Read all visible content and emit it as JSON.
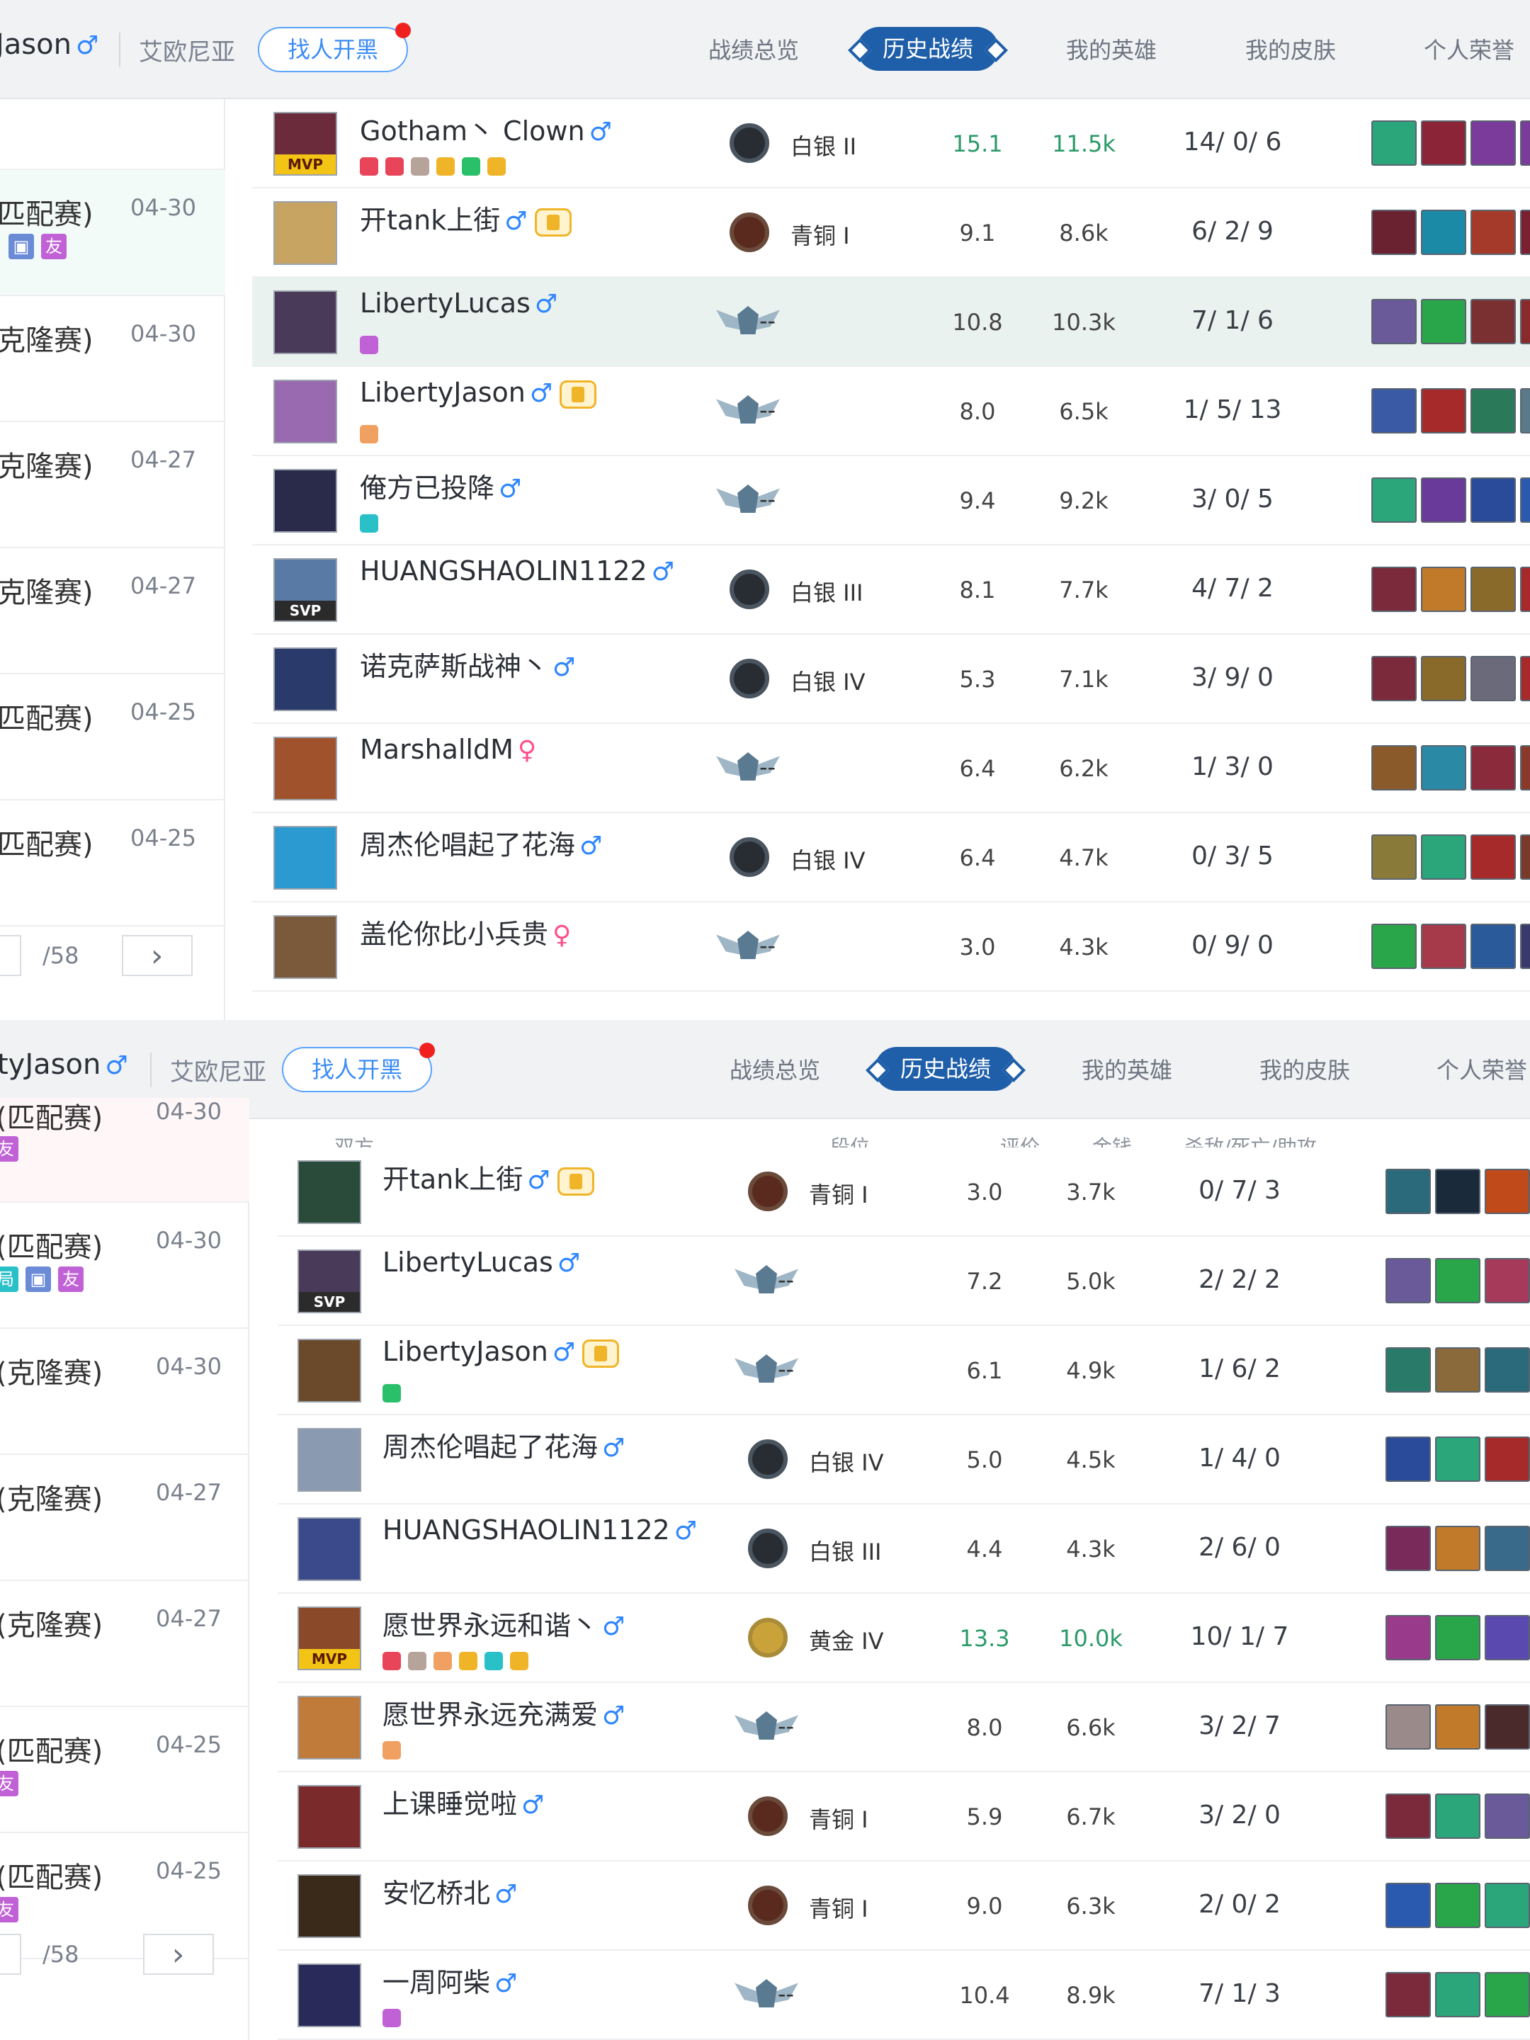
{
  "colors": {
    "accent": "#1f5fa9",
    "male": "#2f86ff",
    "female": "#ff4f8b",
    "green": "#2b9a69"
  },
  "panels": [
    {
      "header": {
        "username": "Jason",
        "server": "艾欧尼亚",
        "find_btn": "找人开黑",
        "tabs": [
          "战绩总览",
          "历史战绩",
          "我的英雄",
          "我的皮肤",
          "个人荣誉"
        ],
        "active_tab": 1
      },
      "matches": [
        {
          "mode": "",
          "date": "",
          "badges": []
        },
        {
          "mode": "匹配赛)",
          "date": "04-30",
          "badges": [
            "pic",
            "friend"
          ]
        },
        {
          "mode": "克隆赛)",
          "date": "04-30",
          "badges": []
        },
        {
          "mode": "克隆赛)",
          "date": "04-27",
          "badges": []
        },
        {
          "mode": "克隆赛)",
          "date": "04-27",
          "badges": []
        },
        {
          "mode": "匹配赛)",
          "date": "04-25",
          "badges": []
        },
        {
          "mode": "匹配赛)",
          "date": "04-25",
          "badges": []
        }
      ],
      "pager": {
        "total": "/58",
        "next": "›"
      },
      "columns": [],
      "players": [
        {
          "name": "Gotham丶 Clown",
          "gender": "male",
          "vip": false,
          "av": "#6b2b3b",
          "mark": "MVP",
          "tags": [
            "#e8455a",
            "#e8455a",
            "#b6a39a",
            "#f0b429",
            "#2ac06a",
            "#f0b429"
          ],
          "rank": "silver",
          "rank_text": "白银 II",
          "score": "15.1",
          "gold": "11.5k",
          "kda": "14/ 0/ 6",
          "green": true,
          "items": [
            "#2aa67a",
            "#8a2436",
            "#7a3b9a",
            "#7a3b9a",
            "#2a4a9a"
          ]
        },
        {
          "name": "开tank上街",
          "gender": "male",
          "vip": true,
          "av": "#c7a462",
          "mark": "",
          "tags": [],
          "rank": "bronze",
          "rank_text": "青铜 I",
          "score": "9.1",
          "gold": "8.6k",
          "kda": "6/ 2/ 9",
          "green": false,
          "items": [
            "#6a2230",
            "#1a8aa6",
            "#a63a2a",
            "#7a2030",
            "#8a6a3a"
          ]
        },
        {
          "name": "LibertyLucas",
          "gender": "male",
          "vip": false,
          "av": "#4a3a5a",
          "mark": "",
          "tags": [
            "#c062d6"
          ],
          "rank": "wing",
          "rank_text": "--",
          "score": "10.8",
          "gold": "10.3k",
          "kda": "7/ 1/ 6",
          "green": false,
          "items": [
            "#6a5a9a",
            "#2aa64a",
            "#7a3030",
            "#8a2a2a",
            "#6a2a2a"
          ],
          "hl": true
        },
        {
          "name": "LibertyJason",
          "gender": "male",
          "vip": true,
          "av": "#9a6ab0",
          "mark": "",
          "tags": [
            "#f0a060"
          ],
          "rank": "wing",
          "rank_text": "--",
          "score": "8.0",
          "gold": "6.5k",
          "kda": "1/ 5/ 13",
          "green": false,
          "items": [
            "#3a5aa6",
            "#a62a2a",
            "#2a7a5a",
            "#5a7a8a",
            "#a66a2a"
          ]
        },
        {
          "name": "俺方已投降",
          "gender": "male",
          "vip": false,
          "av": "#2a2a4a",
          "mark": "",
          "tags": [
            "#2ac0c8"
          ],
          "rank": "wing",
          "rank_text": "--",
          "score": "9.4",
          "gold": "9.2k",
          "kda": "3/ 0/ 5",
          "green": false,
          "items": [
            "#2aa67a",
            "#6a3a9a",
            "#2a4a9a",
            "#2a5ab0",
            "#3a4a8a"
          ]
        },
        {
          "name": "HUANGSHAOLIN1122",
          "gender": "male",
          "vip": false,
          "av": "#5a7aa6",
          "mark": "SVP",
          "tags": [],
          "rank": "silver",
          "rank_text": "白银 III",
          "score": "8.1",
          "gold": "7.7k",
          "kda": "4/ 7/ 2",
          "green": false,
          "items": [
            "#7a2a3a",
            "#c07a2a",
            "#8a6a2a",
            "#a62a2a",
            "#6a2a2a"
          ]
        },
        {
          "name": "诺克萨斯战神丶",
          "gender": "male",
          "vip": false,
          "av": "#2a3a6a",
          "mark": "",
          "tags": [],
          "rank": "silver",
          "rank_text": "白银 IV",
          "score": "5.3",
          "gold": "7.1k",
          "kda": "3/ 9/ 0",
          "green": false,
          "items": [
            "#7a2a3a",
            "#8a6a2a",
            "#6a6a7a",
            "#a62a2a",
            "#3a7a3a"
          ]
        },
        {
          "name": "MarshalldM",
          "gender": "female",
          "vip": false,
          "av": "#a0522d",
          "mark": "",
          "tags": [],
          "rank": "wing",
          "rank_text": "--",
          "score": "6.4",
          "gold": "6.2k",
          "kda": "1/ 3/ 0",
          "green": false,
          "items": [
            "#8a5a2a",
            "#2a8aa6",
            "#8a2a3a",
            "#8a3a2a",
            "#5a3a2a"
          ]
        },
        {
          "name": "周杰伦唱起了花海",
          "gender": "male",
          "vip": false,
          "av": "#2a9ad0",
          "mark": "",
          "tags": [],
          "rank": "silver",
          "rank_text": "白银 IV",
          "score": "6.4",
          "gold": "4.7k",
          "kda": "0/ 3/ 5",
          "green": false,
          "items": [
            "#8a7a3a",
            "#2aa67a",
            "#a62a2a",
            "#7a3a2a",
            "#5a5a3a"
          ]
        },
        {
          "name": "盖伦你比小兵贵",
          "gender": "female",
          "vip": false,
          "av": "#7a5a3a",
          "mark": "",
          "tags": [],
          "rank": "wing",
          "rank_text": "--",
          "score": "3.0",
          "gold": "4.3k",
          "kda": "0/ 9/ 0",
          "green": false,
          "items": [
            "#2aa64a",
            "#a63a4a",
            "#2a5a9a",
            "#3a3a6a",
            "#2a4a8a"
          ]
        }
      ]
    },
    {
      "header": {
        "username": "tyJason",
        "server": "艾欧尼亚",
        "find_btn": "找人开黑",
        "tabs": [
          "战绩总览",
          "历史战绩",
          "我的英雄",
          "我的皮肤",
          "个人荣誉"
        ],
        "active_tab": 1
      },
      "matches": [
        {
          "mode": "(匹配赛)",
          "date": "04-30",
          "badges": [
            "friend"
          ],
          "pink": true,
          "partial": true
        },
        {
          "mode": "(匹配赛)",
          "date": "04-30",
          "badges": [
            "ju",
            "pic",
            "friend"
          ]
        },
        {
          "mode": "(克隆赛)",
          "date": "04-30",
          "badges": []
        },
        {
          "mode": "(克隆赛)",
          "date": "04-27",
          "badges": []
        },
        {
          "mode": "(克隆赛)",
          "date": "04-27",
          "badges": []
        },
        {
          "mode": "(匹配赛)",
          "date": "04-25",
          "badges": [
            "friend"
          ]
        },
        {
          "mode": "(匹配赛)",
          "date": "04-25",
          "badges": [
            "friend"
          ]
        }
      ],
      "pager": {
        "total": "/58",
        "next": "›"
      },
      "columns": [
        "双方",
        "段位",
        "评价",
        "金钱",
        "杀敌/死亡/助攻"
      ],
      "players": [
        {
          "name": "开tank上街",
          "gender": "male",
          "vip": true,
          "av": "#2a4a3a",
          "mark": "",
          "tags": [],
          "rank": "bronze",
          "rank_text": "青铜 I",
          "score": "3.0",
          "gold": "3.7k",
          "kda": "0/ 7/ 3",
          "green": false,
          "items": [
            "#2a6a7a",
            "#1a2a3a",
            "#c04a1a",
            "#3a3a4a",
            "#4a4a5a"
          ]
        },
        {
          "name": "LibertyLucas",
          "gender": "male",
          "vip": false,
          "av": "#4a3a5a",
          "mark": "SVP",
          "tags": [],
          "rank": "wing",
          "rank_text": "--",
          "score": "7.2",
          "gold": "5.0k",
          "kda": "2/ 2/ 2",
          "green": false,
          "items": [
            "#6a5a9a",
            "#2aa64a",
            "#a63a5a",
            "#6a4a3a",
            "#8a3a2a"
          ]
        },
        {
          "name": "LibertyJason",
          "gender": "male",
          "vip": true,
          "av": "#6a4a2a",
          "mark": "",
          "tags": [
            "#2ac06a"
          ],
          "rank": "wing",
          "rank_text": "--",
          "score": "6.1",
          "gold": "4.9k",
          "kda": "1/ 6/ 2",
          "green": false,
          "items": [
            "#2a7a6a",
            "#8a6a3a",
            "#2a6a7a",
            "#6a4a2a",
            "#4a4a4a"
          ]
        },
        {
          "name": "周杰伦唱起了花海",
          "gender": "male",
          "vip": false,
          "av": "#8a9ab0",
          "mark": "",
          "tags": [],
          "rank": "silver",
          "rank_text": "白银 IV",
          "score": "5.0",
          "gold": "4.5k",
          "kda": "1/ 4/ 0",
          "green": false,
          "items": [
            "#2a4a9a",
            "#2aa67a",
            "#a62a2a",
            "#5a5a5a",
            "#4a4a4a"
          ]
        },
        {
          "name": "HUANGSHAOLIN1122",
          "gender": "male",
          "vip": false,
          "av": "#3a4a8a",
          "mark": "",
          "tags": [],
          "rank": "silver",
          "rank_text": "白银 III",
          "score": "4.4",
          "gold": "4.3k",
          "kda": "2/ 6/ 0",
          "green": false,
          "items": [
            "#7a2a5a",
            "#c07a2a",
            "#3a6a8a",
            "#3a4a6a",
            "#4a4a4a"
          ]
        },
        {
          "name": "愿世界永远和谐丶",
          "gender": "male",
          "vip": false,
          "av": "#8a4a2a",
          "mark": "MVP",
          "tags": [
            "#e8455a",
            "#b6a39a",
            "#f0a060",
            "#f0b429",
            "#2ac0c8",
            "#f0b429"
          ],
          "rank": "gold",
          "rank_text": "黄金 IV",
          "score": "13.3",
          "gold": "10.0k",
          "kda": "10/ 1/ 7",
          "green": true,
          "items": [
            "#9a3a8a",
            "#2aa64a",
            "#5a4ab0",
            "#2aa67a",
            "#3a3a6a"
          ]
        },
        {
          "name": "愿世界永远充满爱",
          "gender": "male",
          "vip": false,
          "av": "#c07a3a",
          "mark": "",
          "tags": [
            "#f0a060"
          ],
          "rank": "wing",
          "rank_text": "--",
          "score": "8.0",
          "gold": "6.6k",
          "kda": "3/ 2/ 7",
          "green": false,
          "items": [
            "#9a8a8a",
            "#c07a2a",
            "#4a2a2a",
            "#a63a3a",
            "#5a3a3a"
          ]
        },
        {
          "name": "上课睡觉啦",
          "gender": "male",
          "vip": false,
          "av": "#7a2a2a",
          "mark": "",
          "tags": [],
          "rank": "bronze",
          "rank_text": "青铜 I",
          "score": "5.9",
          "gold": "6.7k",
          "kda": "3/ 2/ 0",
          "green": false,
          "items": [
            "#7a2a3a",
            "#2aa67a",
            "#6a5a9a",
            "#a62a2a",
            "#4a4a4a"
          ]
        },
        {
          "name": "安忆桥北",
          "gender": "male",
          "vip": false,
          "av": "#3a2a1a",
          "mark": "",
          "tags": [],
          "rank": "bronze",
          "rank_text": "青铜 I",
          "score": "9.0",
          "gold": "6.3k",
          "kda": "2/ 0/ 2",
          "green": false,
          "items": [
            "#2a5ab0",
            "#2aa64a",
            "#2aa67a",
            "#3a3a3a",
            "#4a4a4a"
          ]
        },
        {
          "name": "一周阿柴",
          "gender": "male",
          "vip": false,
          "av": "#2a2a5a",
          "mark": "",
          "tags": [
            "#c062d6"
          ],
          "rank": "wing",
          "rank_text": "--",
          "score": "10.4",
          "gold": "8.9k",
          "kda": "7/ 1/ 3",
          "green": false,
          "items": [
            "#7a2a3a",
            "#2aa67a",
            "#2aa64a",
            "#a62a2a",
            "#4a4a4a"
          ]
        }
      ]
    }
  ]
}
